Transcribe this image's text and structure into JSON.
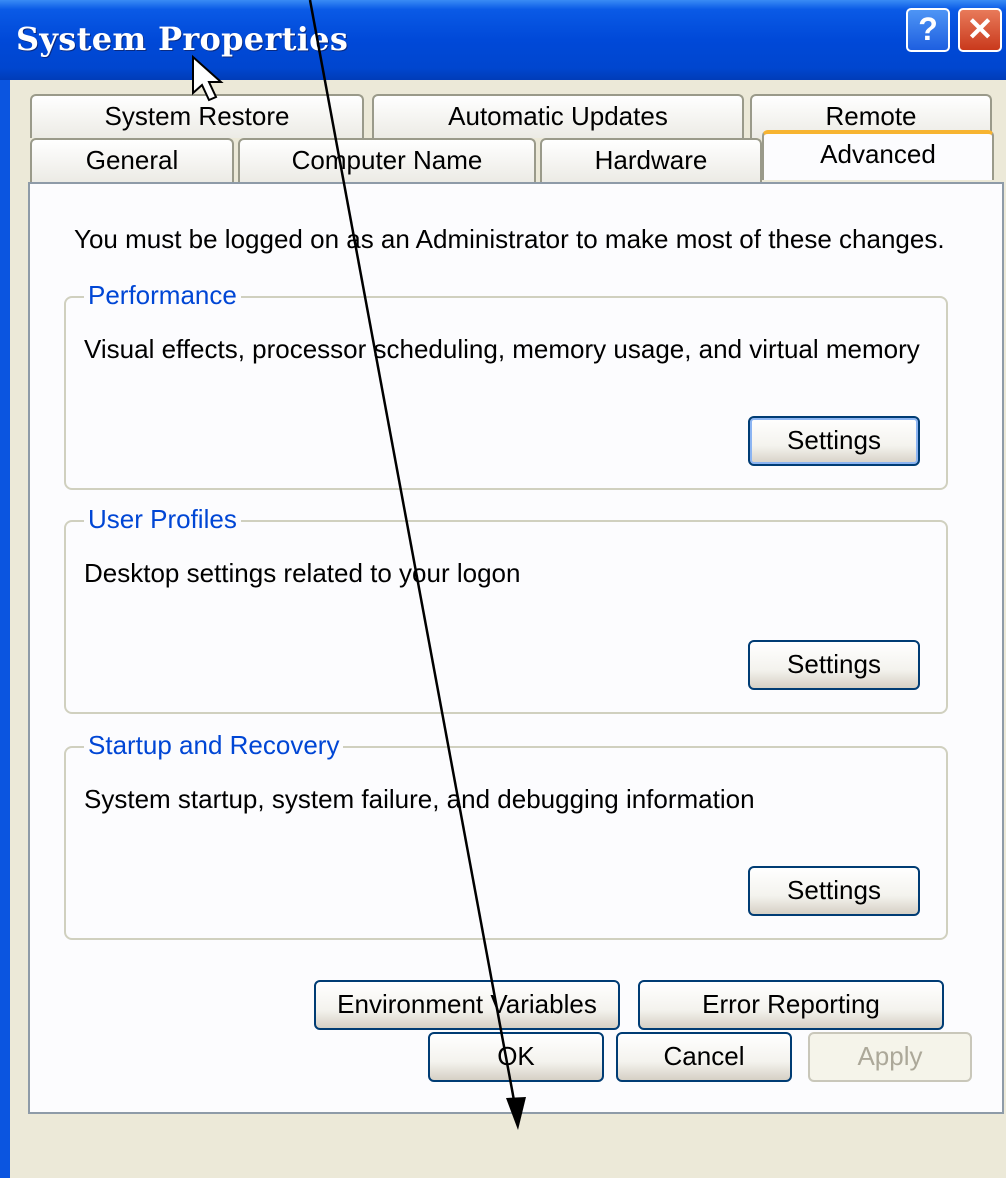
{
  "window": {
    "title": "System Properties",
    "help_glyph": "?",
    "close_glyph": "✕"
  },
  "tabs": {
    "row_back": [
      "System Restore",
      "Automatic Updates",
      "Remote"
    ],
    "row_front": [
      "General",
      "Computer Name",
      "Hardware",
      "Advanced"
    ],
    "active": "Advanced"
  },
  "advanced": {
    "intro": "You must be logged on as an Administrator to make most of these changes.",
    "performance": {
      "legend": "Performance",
      "description": "Visual effects, processor scheduling, memory usage, and virtual memory",
      "button": "Settings"
    },
    "user_profiles": {
      "legend": "User Profiles",
      "description": "Desktop settings related to your logon",
      "button": "Settings"
    },
    "startup_recovery": {
      "legend": "Startup and Recovery",
      "description": "System startup, system failure, and debugging information",
      "button": "Settings"
    },
    "env_button": "Environment Variables",
    "error_button": "Error Reporting"
  },
  "footer": {
    "ok": "OK",
    "cancel": "Cancel",
    "apply": "Apply"
  },
  "colors": {
    "titlebar": "#0046cf",
    "dialog_bg": "#ece9d8",
    "legend_text": "#0046d5",
    "active_tab_accent": "#f7b431"
  },
  "icons": [
    "mouse-cursor-icon",
    "help-icon",
    "close-icon"
  ]
}
